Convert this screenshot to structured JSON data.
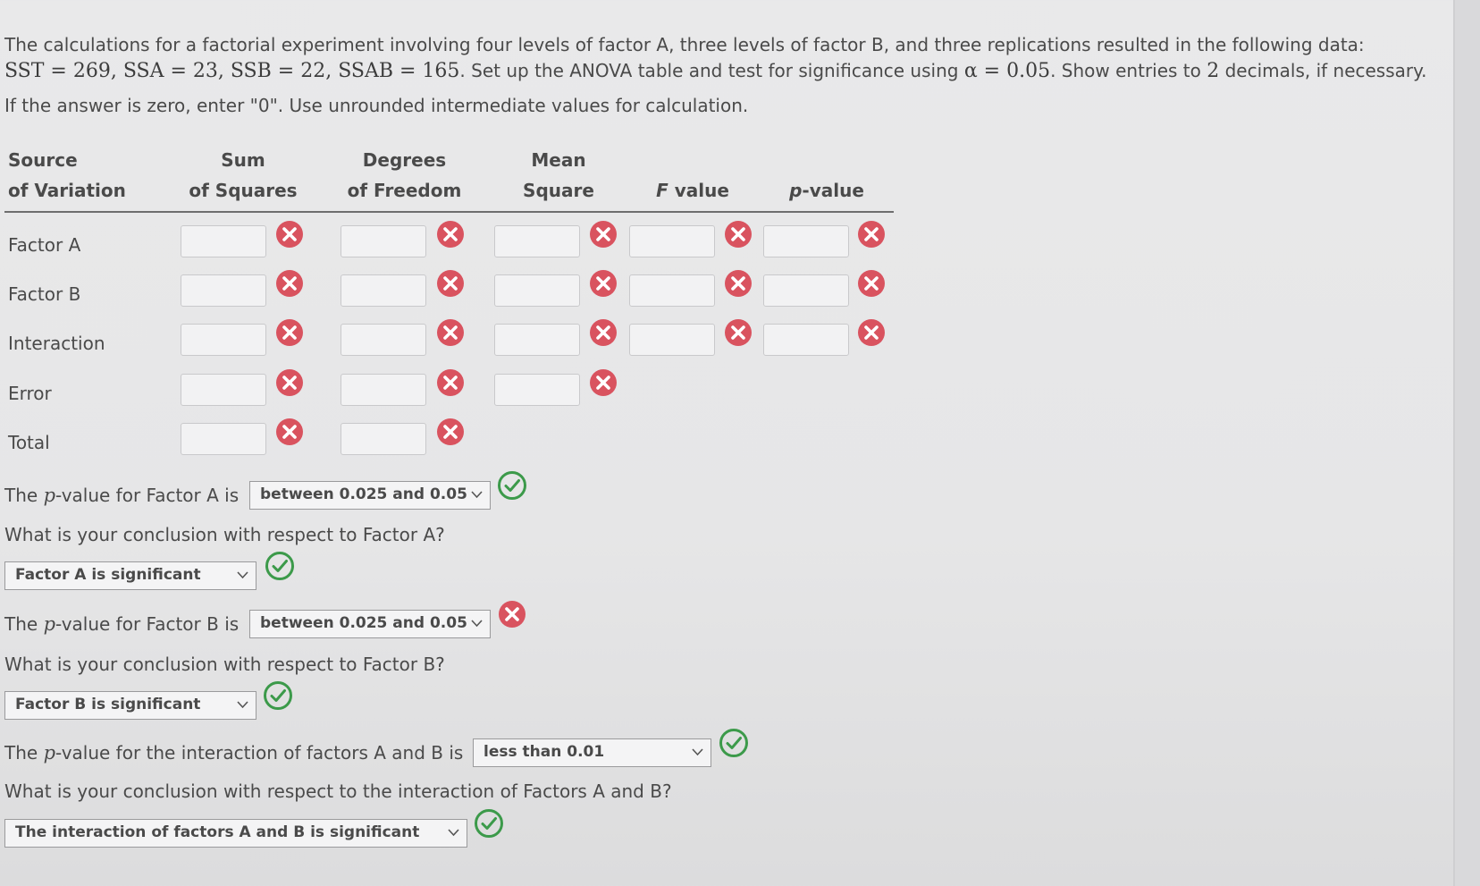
{
  "problem": {
    "line1": "The calculations for a factorial experiment involving four levels of factor A, three levels of factor B, and three replications resulted in the following data:",
    "line2_math": "SST = 269, SSA = 23, SSB = 22, SSAB = 165",
    "line2_text_a": ". Set up the ANOVA table and test for significance using ",
    "line2_alpha": "α = 0.05",
    "line2_text_b": ". Show entries to ",
    "line2_two": "2",
    "line2_text_c": " decimals, if necessary.",
    "line3": "If the answer is zero, enter \"0\". Use unrounded intermediate values for calculation."
  },
  "table": {
    "headers": {
      "source_1": "Source",
      "source_2": "of Variation",
      "ss_1": "Sum",
      "ss_2": "of Squares",
      "df_1": "Degrees",
      "df_2": "of Freedom",
      "ms_1": "Mean",
      "ms_2": "Square",
      "f_letter": "F",
      "f_rest": " value",
      "p_letter": "p",
      "p_rest": "-value"
    },
    "rows": [
      {
        "label": "Factor A"
      },
      {
        "label": "Factor B"
      },
      {
        "label": "Interaction"
      },
      {
        "label": "Error"
      },
      {
        "label": "Total"
      }
    ]
  },
  "questions": {
    "pA_prefix": "The ",
    "pA_p": "p",
    "pA_suffix": "-value for Factor A is",
    "pA_selected": "between 0.025 and 0.05",
    "concA_question": "What is your conclusion with respect to Factor A?",
    "concA_selected": "Factor A is significant",
    "pB_prefix": "The ",
    "pB_p": "p",
    "pB_suffix": "-value for Factor B is",
    "pB_selected": "between 0.025 and 0.05",
    "concB_question": "What is your conclusion with respect to Factor B?",
    "concB_selected": "Factor B is significant",
    "pAB_prefix": "The ",
    "pAB_p": "p",
    "pAB_suffix": "-value for the interaction of factors A and B is",
    "pAB_selected": "less than 0.01",
    "concAB_question": "What is your conclusion with respect to the interaction of Factors A and B?",
    "concAB_selected": "The interaction of factors A and B is significant"
  },
  "colors": {
    "incorrect": "#d9535f",
    "correct": "#3c9a4a"
  },
  "icons": {
    "incorrect": "x-circle-icon",
    "correct": "check-circle-icon",
    "dropdown": "chevron-down-icon"
  }
}
